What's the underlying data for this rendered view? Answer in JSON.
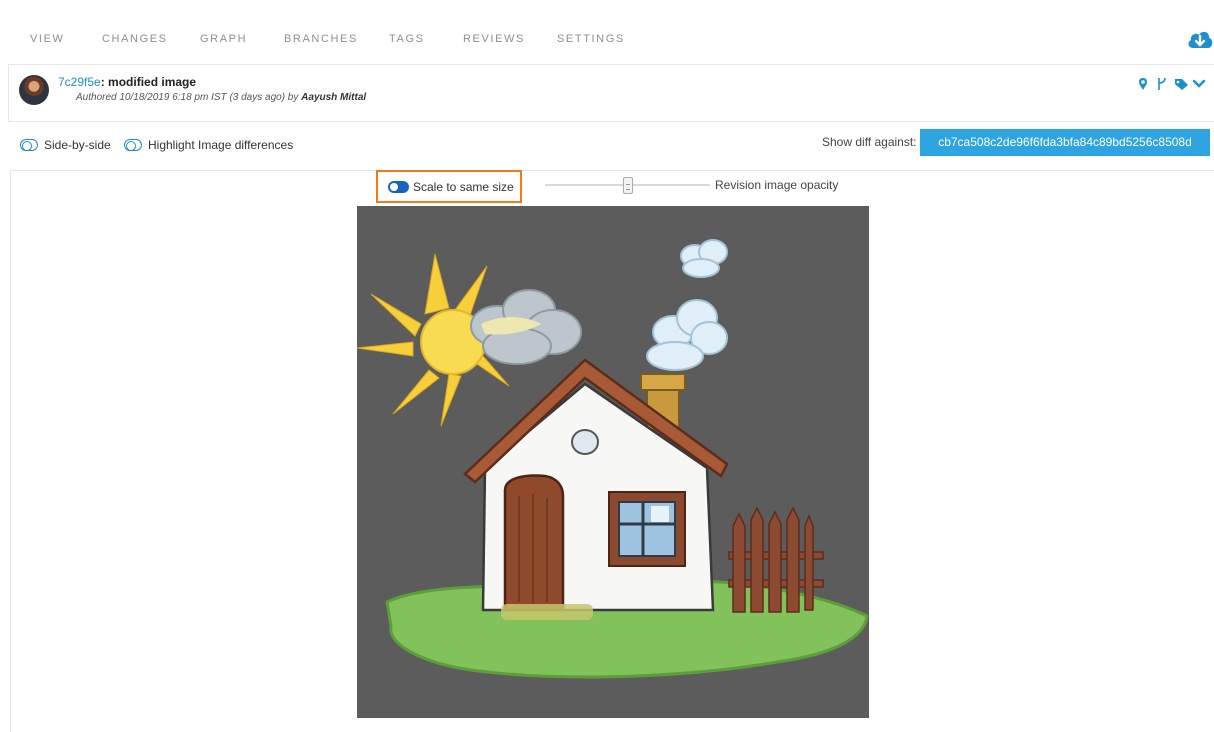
{
  "nav": {
    "tabs": [
      {
        "label": "VIEW"
      },
      {
        "label": "CHANGES"
      },
      {
        "label": "GRAPH"
      },
      {
        "label": "BRANCHES"
      },
      {
        "label": "TAGS"
      },
      {
        "label": "REVIEWS"
      },
      {
        "label": "SETTINGS"
      }
    ],
    "cloud_icon": "cloud-download-icon"
  },
  "commit": {
    "hash": "7c29f5e",
    "separator": ":",
    "title": "modified image",
    "meta": "Authored  10/18/2019 6:18 pm IST (3 days ago) by",
    "author": "Aayush Mittal",
    "icons": [
      "map-marker-icon",
      "branch-icon",
      "tag-icon",
      "chevron-down-icon"
    ]
  },
  "options": {
    "side_by_side": "Side-by-side",
    "highlight": "Highlight Image differences",
    "diff_against_label": "Show diff against:",
    "diff_against_value": "cb7ca508c2de96f6fda3bfa84c89bd5256c8508d"
  },
  "diff_view": {
    "scale_label": "Scale to same size",
    "scale_enabled": true,
    "opacity_label": "Revision image opacity",
    "opacity_level": 0.5
  },
  "colors": {
    "accent": "#1a90cf",
    "button": "#2ea4e0",
    "highlight_border": "#f07b1f",
    "image_bg": "#5c5c5c"
  }
}
